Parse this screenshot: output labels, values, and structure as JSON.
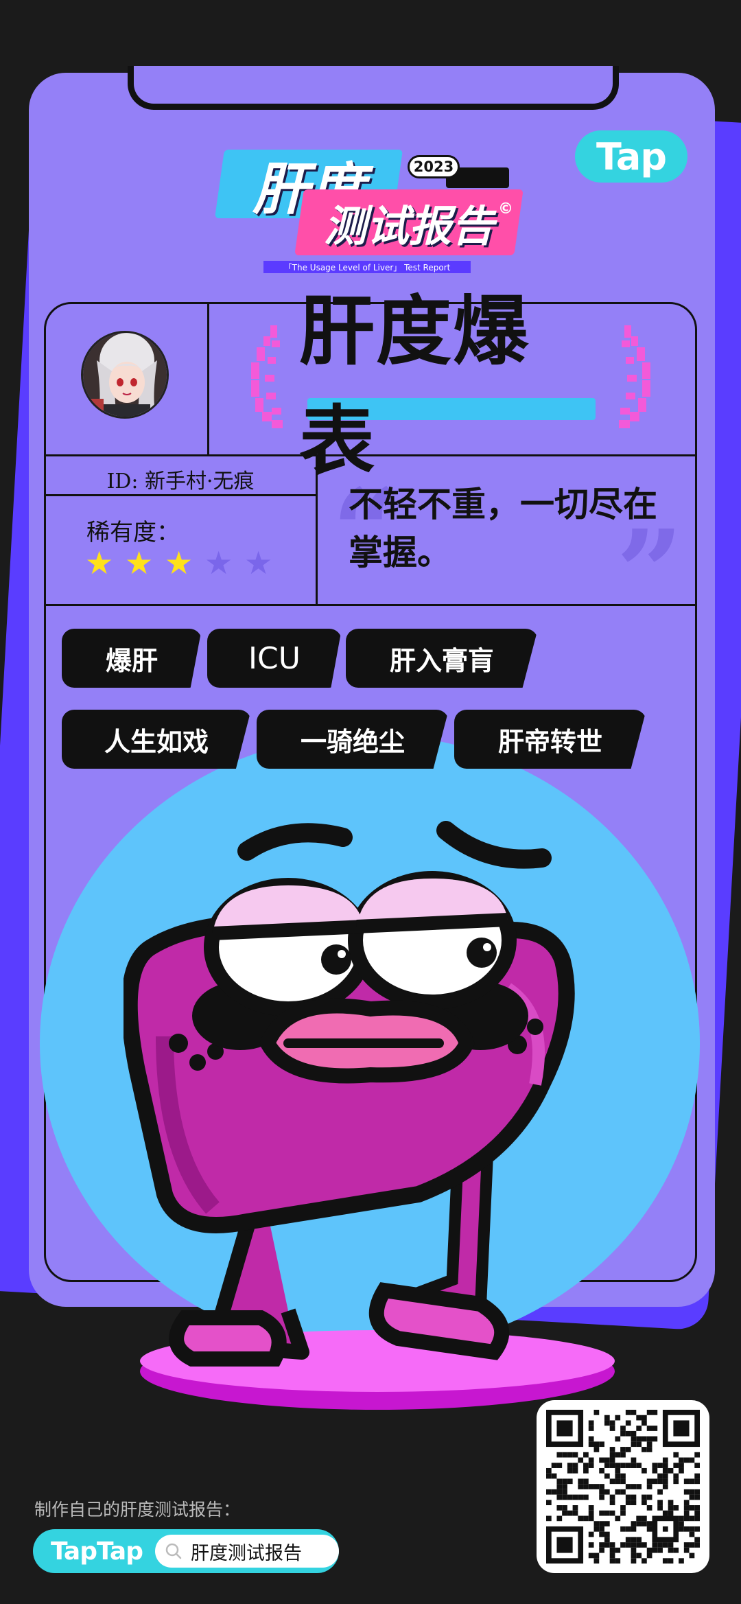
{
  "header": {
    "brand": "Tap",
    "title_line1": "肝度",
    "year": "2023",
    "title_line2": "测试报告",
    "copyright": "©",
    "subtitle": "「The Usage Level of Liver」 Test Report"
  },
  "profile": {
    "verdict": "肝度爆表",
    "id": "ID: 新手村·无痕",
    "rarity_label": "稀有度：",
    "rarity": {
      "value": 3,
      "max": 5
    },
    "quote": "不轻不重，一切尽在掌握。"
  },
  "tags": {
    "row1": [
      "爆肝",
      "ICU",
      "肝入膏肓"
    ],
    "row2": [
      "人生如戏",
      "一骑绝尘",
      "肝帝转世"
    ]
  },
  "footer": {
    "make_label": "制作自己的肝度测试报告：",
    "brand": "TapTap",
    "search_text": "肝度测试报告"
  },
  "colors": {
    "background": "#1b1b1b",
    "card": "#9480f7",
    "card_shadow": "#5a3dff",
    "accent_cyan": "#34d3e0",
    "accent_pink": "#ff4fa9",
    "sky_blue": "#5ec4fb",
    "liver_magenta": "#c02aa8",
    "star_filled": "#ffe11a",
    "star_empty": "#7a66ea"
  },
  "icons": {
    "search": "search-icon",
    "star": "star-icon",
    "laurel": "laurel-icon"
  }
}
